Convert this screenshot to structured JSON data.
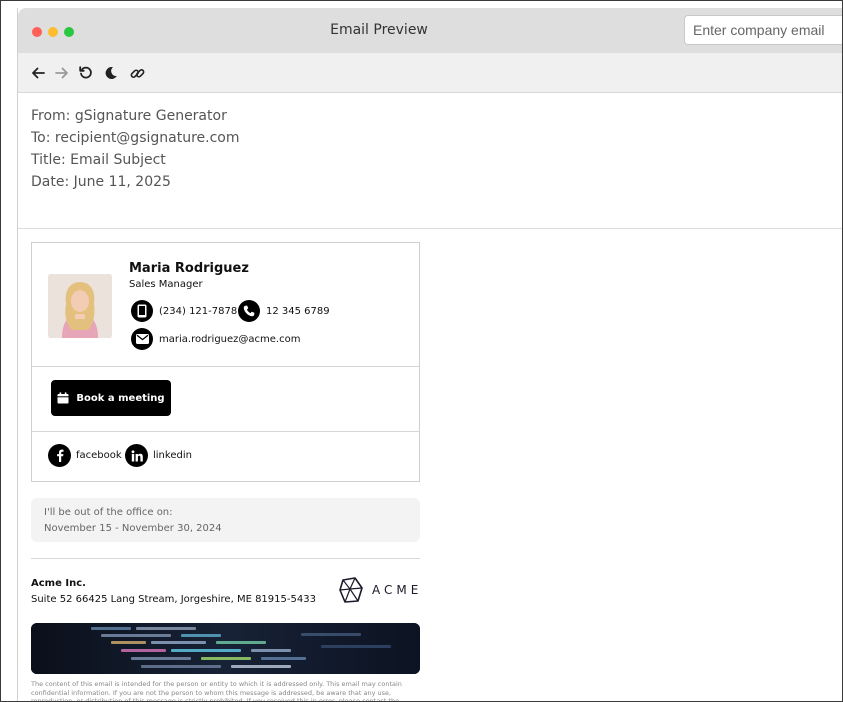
{
  "window": {
    "title": "Email Preview",
    "email_input_placeholder": "Enter company email"
  },
  "toolbar": {
    "icons": [
      "arrow-left-icon",
      "arrow-right-icon",
      "refresh-icon",
      "moon-icon",
      "link-icon"
    ]
  },
  "email_header": {
    "from": "From: gSignature Generator",
    "to": "To: recipient@gsignature.com",
    "title": "Title: Email Subject",
    "date": "Date: June 11, 2025"
  },
  "signature": {
    "name": "Maria Rodriguez",
    "role": "Sales Manager",
    "mobile": "(234) 121-7878",
    "phone": "12 345 6789",
    "email": "maria.rodriguez@acme.com",
    "book_button": "Book a meeting",
    "social": [
      {
        "label": "facebook",
        "icon": "facebook-icon"
      },
      {
        "label": "linkedin",
        "icon": "linkedin-icon"
      }
    ]
  },
  "out_of_office": {
    "label": "I'll be out of the office on:",
    "dates": "November 15 - November 30, 2024"
  },
  "company": {
    "name": "Acme Inc.",
    "address": "Suite 52 66425 Lang Stream, Jorgeshire, ME 81915-5433",
    "logo_text": "ACME"
  },
  "disclaimer": "The content of this email is intended for the person or entity to which it is addressed only. This email may contain confidential information. If you are not the person to whom this message is addressed, be aware that any use, reproduction, or distribution of this message is strictly prohibited. If you received this in error, please contact the sender and immediately delete this email and any attachments.",
  "colors": {
    "titlebar": "#dedede",
    "toolbar": "#f0f0f0",
    "accent_black": "#000000",
    "ooo_background": "#f3f3f3"
  }
}
